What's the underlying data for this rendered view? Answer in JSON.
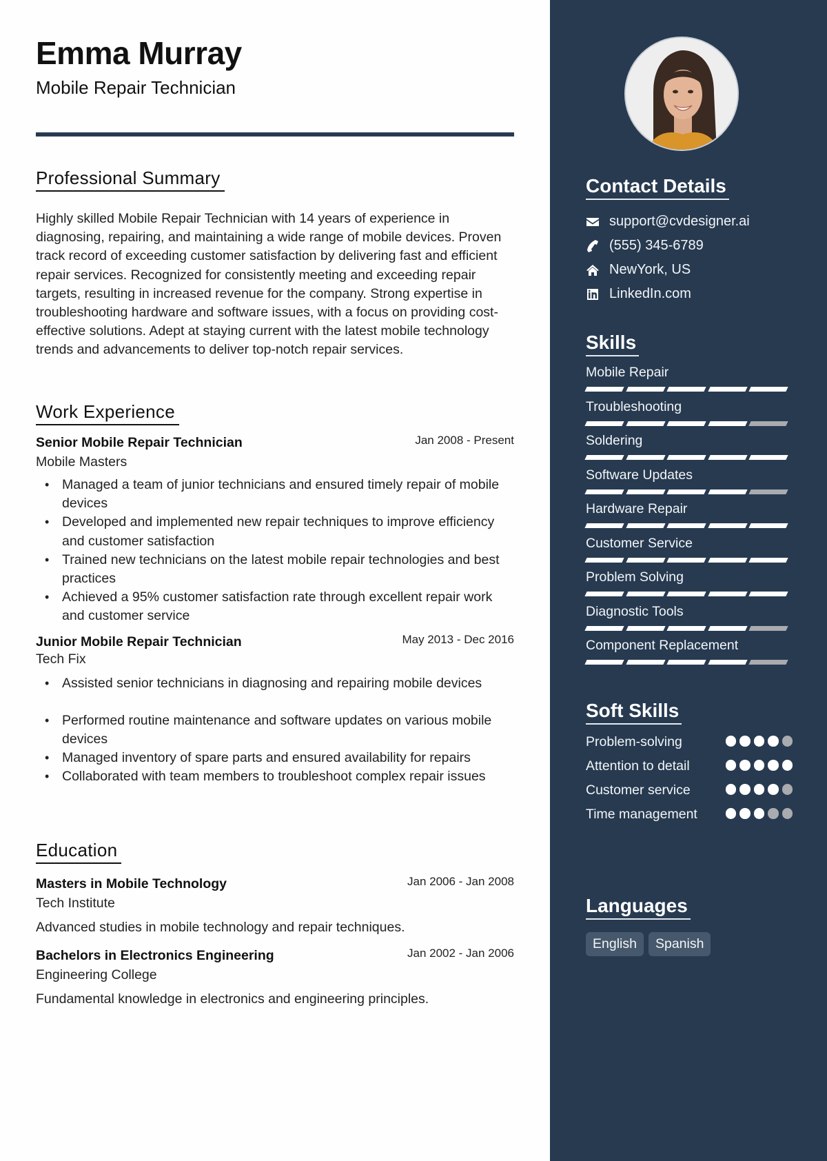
{
  "header": {
    "name": "Emma Murray",
    "title": "Mobile Repair Technician"
  },
  "summary": {
    "heading": "Professional Summary",
    "text": "Highly skilled Mobile Repair Technician with 14 years of experience in diagnosing, repairing, and maintaining a wide range of mobile devices. Proven track record of exceeding customer satisfaction by delivering fast and efficient repair services. Recognized for consistently meeting and exceeding repair targets, resulting in increased revenue for the company. Strong expertise in troubleshooting hardware and software issues, with a focus on providing cost-effective solutions. Adept at staying current with the latest mobile technology trends and advancements to deliver top-notch repair services."
  },
  "experience": {
    "heading": "Work Experience",
    "jobs": [
      {
        "title": "Senior Mobile Repair Technician",
        "company": "Mobile Masters",
        "dates": "Jan 2008 - Present",
        "bullets": [
          "Managed a team of junior technicians and ensured timely repair of mobile devices",
          "Developed and implemented new repair techniques to improve efficiency and customer satisfaction",
          "Trained new technicians on the latest mobile repair technologies and best practices",
          "Achieved a 95% customer satisfaction rate through excellent repair work and customer service"
        ]
      },
      {
        "title": "Junior Mobile Repair Technician",
        "company": "Tech Fix",
        "dates": "May 2013 - Dec 2016",
        "bullets": [
          "Assisted senior technicians in diagnosing and repairing mobile devices",
          "Performed routine maintenance and software updates on various mobile devices",
          "Managed inventory of spare parts and ensured availability for repairs",
          "Collaborated with team members to troubleshoot complex repair issues"
        ]
      }
    ]
  },
  "education": {
    "heading": "Education",
    "items": [
      {
        "degree": "Masters in Mobile Technology",
        "school": "Tech Institute",
        "dates": "Jan 2006 - Jan 2008",
        "description": "Advanced studies in mobile technology and repair techniques."
      },
      {
        "degree": "Bachelors in Electronics Engineering",
        "school": "Engineering College",
        "dates": "Jan 2002 - Jan 2006",
        "description": "Fundamental knowledge in electronics and engineering principles."
      }
    ]
  },
  "contact": {
    "heading": "Contact Details",
    "items": [
      {
        "icon": "envelope-icon",
        "text": "support@cvdesigner.ai"
      },
      {
        "icon": "phone-icon",
        "text": "(555) 345-6789"
      },
      {
        "icon": "home-icon",
        "text": "NewYork, US"
      },
      {
        "icon": "linkedin-icon",
        "text": "LinkedIn.com"
      }
    ]
  },
  "skills": {
    "heading": "Skills",
    "max": 5,
    "items": [
      {
        "name": "Mobile Repair",
        "level": 5
      },
      {
        "name": "Troubleshooting",
        "level": 4
      },
      {
        "name": "Soldering",
        "level": 5
      },
      {
        "name": "Software Updates",
        "level": 4
      },
      {
        "name": "Hardware Repair",
        "level": 5
      },
      {
        "name": "Customer Service",
        "level": 5
      },
      {
        "name": "Problem Solving",
        "level": 5
      },
      {
        "name": "Diagnostic Tools",
        "level": 4
      },
      {
        "name": "Component Replacement",
        "level": 4
      }
    ]
  },
  "soft_skills": {
    "heading": "Soft Skills",
    "max": 5,
    "items": [
      {
        "name": "Problem-solving",
        "level": 4
      },
      {
        "name": "Attention to detail",
        "level": 5
      },
      {
        "name": "Customer service",
        "level": 4
      },
      {
        "name": "Time management",
        "level": 3
      }
    ]
  },
  "languages": {
    "heading": "Languages",
    "items": [
      "English",
      "Spanish"
    ]
  },
  "colors": {
    "sidebar": "#273a50",
    "rule": "#273a50",
    "level_on": "#ffffff",
    "level_off": "#a9abae",
    "language_pill": "#46586c"
  }
}
